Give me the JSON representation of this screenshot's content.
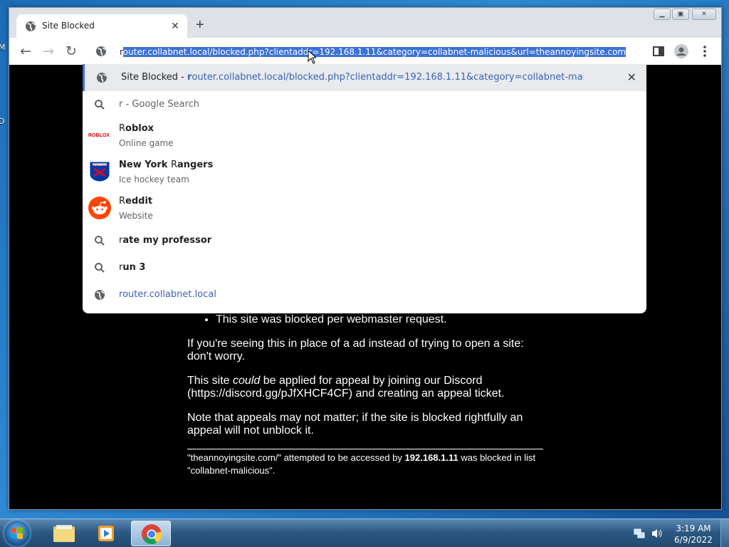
{
  "desktop": {
    "icon_fragments": [
      "M",
      "D"
    ]
  },
  "browser": {
    "tab": {
      "title": "Site Blocked"
    },
    "omnibox": {
      "url": "router.collabnet.local/blocked.php?clientaddr=192.168.1.11&category=collabnet-malicious&url=theannoyingsite.com",
      "typed": "r",
      "selected": "outer.collabnet.local/blocked.php?clientaddr=192.168.1.11&category=collabnet-malicious&url=theannoyingsite.com"
    }
  },
  "dropdown": {
    "items": [
      {
        "type": "history",
        "title": "Site Blocked",
        "sep": " - ",
        "url_typed": "r",
        "url_rest": "outer.collabnet.local/blocked.php?clientaddr=192.168.1.11&category=collabnet-malicious&url=..."
      },
      {
        "type": "search",
        "typed": "r",
        "rest": " - Google Search"
      },
      {
        "type": "entity",
        "typed": "R",
        "rest": "oblox",
        "sub": "Online game",
        "logo_text": "ROBLOX"
      },
      {
        "type": "entity",
        "typed_pre": "New York ",
        "typed": "R",
        "rest": "angers",
        "sub": "Ice hockey team",
        "logo_text": "NEW YORK"
      },
      {
        "type": "entity",
        "typed": "R",
        "rest": "eddit",
        "sub": "Website"
      },
      {
        "type": "search",
        "typed": "r",
        "rest": "ate my professor"
      },
      {
        "type": "search",
        "typed": "r",
        "rest": "un 3"
      },
      {
        "type": "url",
        "typed": "r",
        "rest": "outer.collabnet.local"
      }
    ]
  },
  "page": {
    "bullet": "This site was blocked per webmaster request.",
    "p1": "If you're seeing this in place of a ad instead of trying to open a site: don't worry.",
    "p2_a": "This site ",
    "p2_em": "could",
    "p2_b": " be applied for appeal by joining our Discord (https://discord.gg/pJfXHCF4CF) and creating an appeal ticket.",
    "p3": "Note that appeals may not matter; if the site is blocked rightfully an appeal will not unblock it.",
    "foot_a": "\"theannoyingsite.com/\" attempted to be accessed by ",
    "foot_ip": "192.168.1.11",
    "foot_b": " was blocked in list \"collabnet-malicious\"."
  },
  "taskbar": {
    "time": "3:19 AM",
    "date": "6/9/2022"
  },
  "colors": {
    "accent": "#3b72d6",
    "link": "#3b62b6",
    "reddit": "#ff4500",
    "rangers": "#0038a8"
  }
}
